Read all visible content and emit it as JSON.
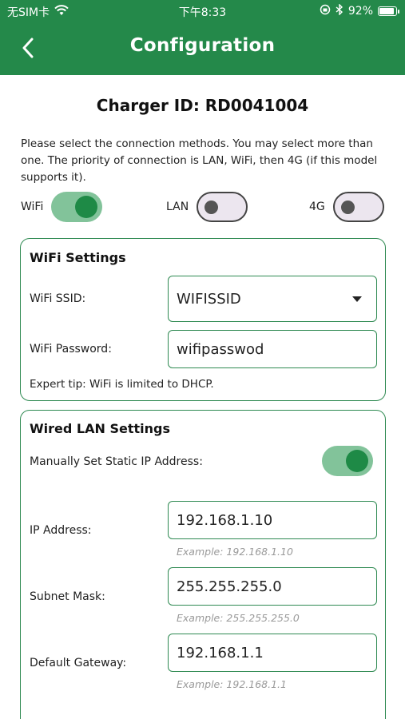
{
  "status_bar": {
    "carrier": "无SIM卡",
    "time": "下午8:33",
    "battery": "92%",
    "battery_level": 0.92
  },
  "header": {
    "title": "Configuration"
  },
  "charger_id": "Charger ID: RD0041004",
  "intro_text": "Please select the connection methods. You may select more than one. The priority of connection is LAN, WiFi, then 4G (if this model supports it).",
  "connection_toggles": [
    {
      "label": "WiFi",
      "on": true
    },
    {
      "label": "LAN",
      "on": false
    },
    {
      "label": "4G",
      "on": false
    }
  ],
  "wifi_settings": {
    "title": "WiFi Settings",
    "ssid_label": "WiFi SSID:",
    "ssid_value": "WIFISSID",
    "password_label": "WiFi Password:",
    "password_value": "wifipasswod",
    "tip": "Expert tip: WiFi is limited to DHCP."
  },
  "lan_settings": {
    "title": "Wired LAN Settings",
    "static_ip_label": "Manually Set Static IP Address:",
    "static_ip_on": true,
    "ip_label": "IP Address:",
    "ip_value": "192.168.1.10",
    "ip_hint": "Example: 192.168.1.10",
    "subnet_label": "Subnet Mask:",
    "subnet_value": "255.255.255.0",
    "subnet_hint": "Example: 255.255.255.0",
    "gateway_label": "Default Gateway:",
    "gateway_value": "192.168.1.1",
    "gateway_hint": "Example: 192.168.1.1"
  }
}
